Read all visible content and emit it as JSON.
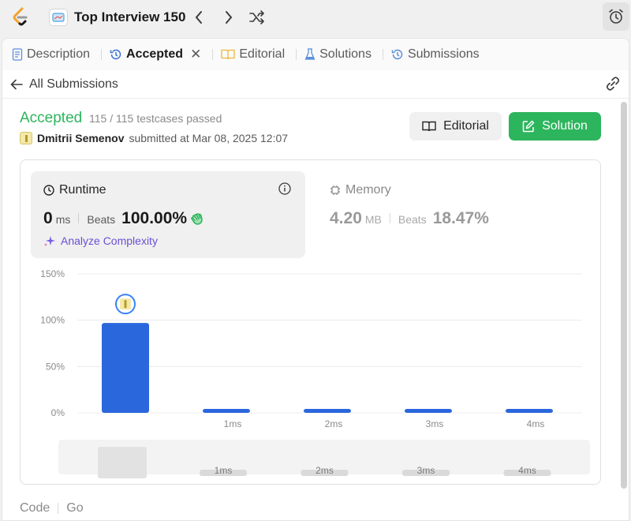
{
  "topbar": {
    "study_title": "Top Interview 150"
  },
  "tabs": [
    {
      "label": "Description",
      "icon": "document-icon"
    },
    {
      "label": "Accepted",
      "icon": "history-icon",
      "active": true
    },
    {
      "label": "Editorial",
      "icon": "book-icon"
    },
    {
      "label": "Solutions",
      "icon": "flask-icon"
    },
    {
      "label": "Submissions",
      "icon": "history-icon"
    }
  ],
  "subbar": {
    "back_label": "All Submissions"
  },
  "result": {
    "status": "Accepted",
    "testcases": "115 / 115 testcases passed",
    "user": "Dmitrii Semenov",
    "submitted": "submitted at Mar 08, 2025 12:07"
  },
  "buttons": {
    "editorial": "Editorial",
    "solution": "Solution"
  },
  "runtime": {
    "title": "Runtime",
    "value": "0",
    "unit": "ms",
    "beats_label": "Beats",
    "beats_value": "100.00%",
    "analyze": "Analyze Complexity"
  },
  "memory": {
    "title": "Memory",
    "value": "4.20",
    "unit": "MB",
    "beats_label": "Beats",
    "beats_value": "18.47%"
  },
  "chart_data": {
    "type": "bar",
    "categories": [
      "",
      "1ms",
      "2ms",
      "3ms",
      "4ms"
    ],
    "values": [
      97,
      3,
      3,
      3,
      3
    ],
    "ylim": [
      0,
      150
    ],
    "yticks": [
      "150%",
      "100%",
      "50%",
      "0%"
    ],
    "grid": true,
    "bar_color": "#2b67dc",
    "overview_labels": [
      "1ms",
      "2ms",
      "3ms",
      "4ms"
    ]
  },
  "footer": {
    "code_label": "Code",
    "lang": "Go"
  },
  "colors": {
    "accepted": "#2db55d",
    "analyze": "#6b4fd6"
  }
}
